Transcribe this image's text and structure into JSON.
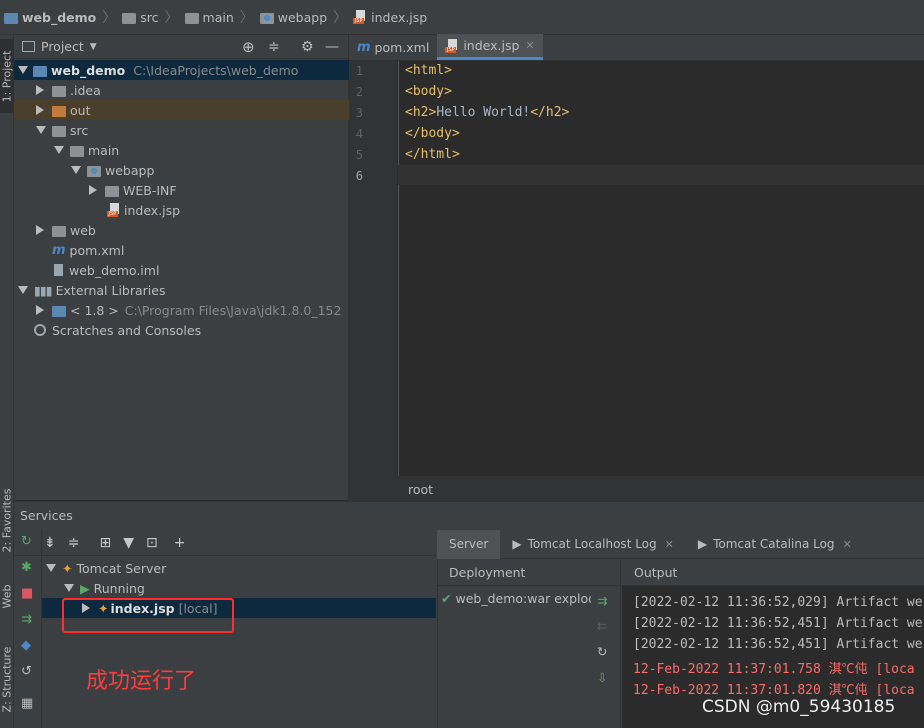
{
  "navbar": {
    "crumbs": [
      "web_demo",
      "src",
      "main",
      "webapp",
      "index.jsp"
    ]
  },
  "left_stripe": {
    "project_tab": "1: Project",
    "favorites_tab": "2: Favorites",
    "web_tab": "Web",
    "structure_tab": "Z: Structure"
  },
  "project": {
    "header_label": "Project",
    "tree": [
      {
        "label": "web_demo",
        "path": "C:\\IdeaProjects\\web_demo"
      },
      {
        "label": ".idea"
      },
      {
        "label": "out"
      },
      {
        "label": "src"
      },
      {
        "label": "main"
      },
      {
        "label": "webapp"
      },
      {
        "label": "WEB-INF"
      },
      {
        "label": "index.jsp"
      },
      {
        "label": "web"
      },
      {
        "label": "pom.xml"
      },
      {
        "label": "web_demo.iml"
      },
      {
        "label": "External Libraries"
      },
      {
        "label": "< 1.8 >",
        "path": "C:\\Program Files\\Java\\jdk1.8.0_152"
      },
      {
        "label": "Scratches and Consoles"
      }
    ]
  },
  "editor": {
    "tabs": [
      {
        "label": "pom.xml",
        "icon": "maven-icon"
      },
      {
        "label": "index.jsp",
        "icon": "jsp-icon"
      }
    ],
    "line_numbers": [
      "1",
      "2",
      "3",
      "4",
      "5",
      "6"
    ],
    "lines": [
      {
        "pre": "<html>",
        "text": "",
        "post": ""
      },
      {
        "pre": "<body>",
        "text": "",
        "post": ""
      },
      {
        "pre": "<h2>",
        "text": "Hello World!",
        "post": "</h2>"
      },
      {
        "pre": "</body>",
        "text": "",
        "post": ""
      },
      {
        "pre": "</html>",
        "text": "",
        "post": ""
      },
      {
        "pre": "",
        "text": "",
        "post": ""
      }
    ],
    "breadcrumb": "root"
  },
  "services": {
    "title": "Services",
    "tree": [
      {
        "label": "Tomcat Server"
      },
      {
        "label": "Running"
      },
      {
        "label": "index.jsp",
        "suffix": "[local]"
      }
    ],
    "right_tabs": [
      "Server",
      "Tomcat Localhost Log",
      "Tomcat Catalina Log"
    ],
    "deployment_header": "Deployment",
    "output_header": "Output",
    "deployment_item": "web_demo:war explode",
    "output_lines": [
      {
        "text": "[2022-02-12 11:36:52,029] Artifact we",
        "color": "normal"
      },
      {
        "text": "[2022-02-12 11:36:52,451] Artifact we",
        "color": "normal"
      },
      {
        "text": "[2022-02-12 11:36:52,451] Artifact we",
        "color": "normal"
      },
      {
        "text": "12-Feb-2022 11:37:01.758 淇℃伅 [loca",
        "color": "red"
      },
      {
        "text": "12-Feb-2022 11:37:01.820 淇℃伅 [loca",
        "color": "red"
      }
    ]
  },
  "annotation": {
    "text": "成功运行了"
  },
  "watermark": "CSDN @m0_59430185",
  "colors": {
    "accent": "#4a88c7",
    "selection": "#0d293e",
    "error_red": "#ff6b68",
    "annotation_red": "#ff2d2d",
    "tag_color": "#e8bf6a"
  }
}
